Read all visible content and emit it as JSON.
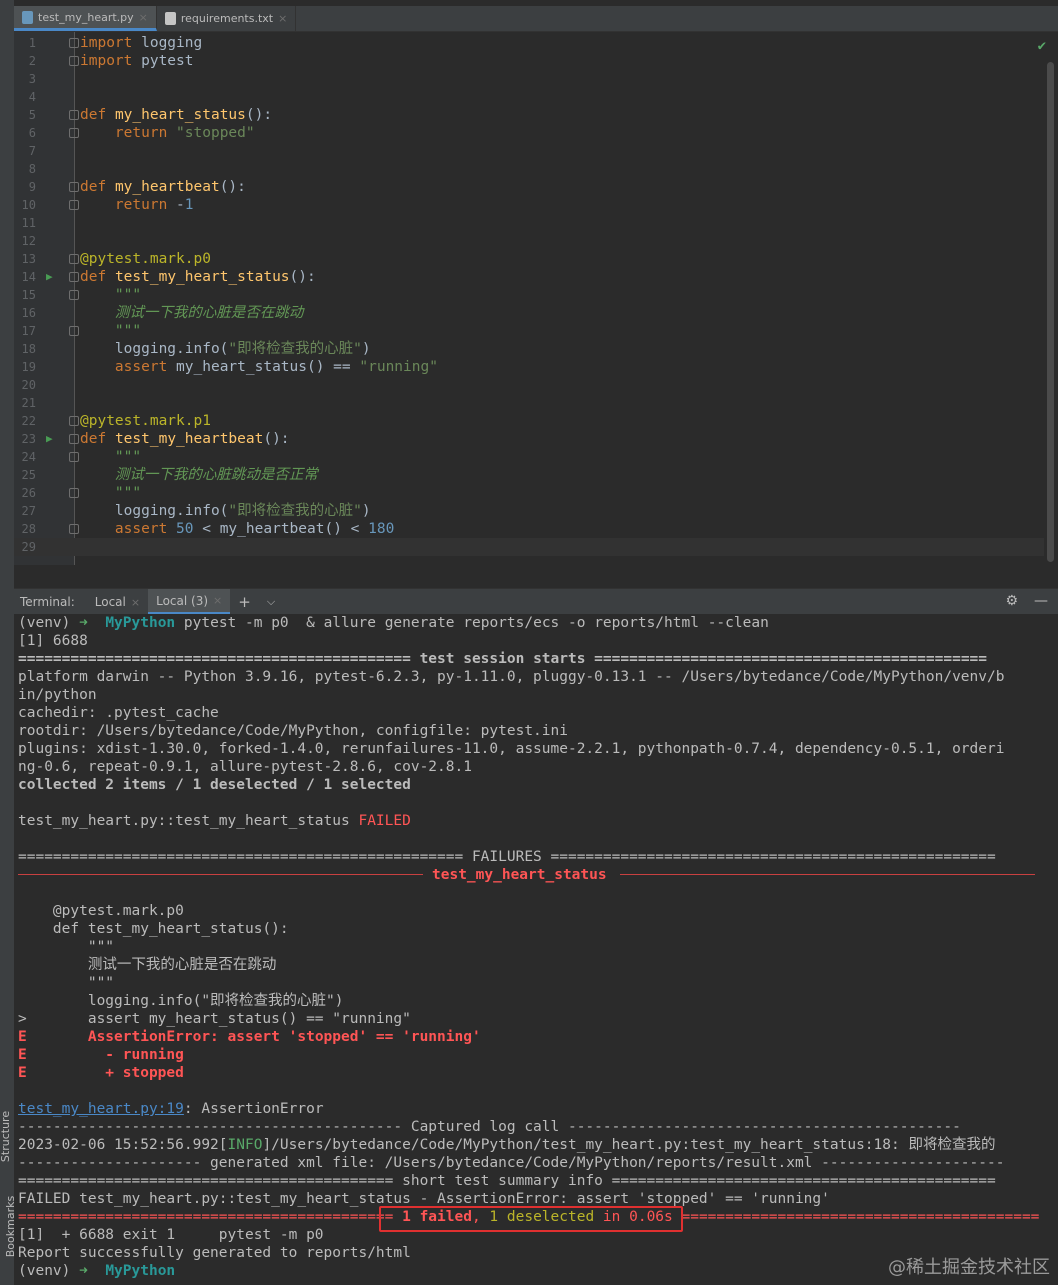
{
  "editor_tabs": [
    {
      "name": "test_my_heart.py"
    },
    {
      "name": "requirements.txt"
    }
  ],
  "code_lines": [
    "import logging",
    "import pytest",
    "",
    "",
    "def my_heart_status():",
    "    return \"stopped\"",
    "",
    "",
    "def my_heartbeat():",
    "    return -1",
    "",
    "",
    "@pytest.mark.p0",
    "def test_my_heart_status():",
    "    \"\"\"",
    "    测试一下我的心脏是否在跳动",
    "    \"\"\"",
    "    logging.info(\"即将检查我的心脏\")",
    "    assert my_heart_status() == \"running\"",
    "",
    "",
    "@pytest.mark.p1",
    "def test_my_heartbeat():",
    "    \"\"\"",
    "    测试一下我的心脏跳动是否正常",
    "    \"\"\"",
    "    logging.info(\"即将检查我的心脏\")",
    "    assert 50 < my_heartbeat() < 180",
    ""
  ],
  "line_numbers": [
    "1",
    "2",
    "3",
    "4",
    "5",
    "6",
    "7",
    "8",
    "9",
    "10",
    "11",
    "12",
    "13",
    "14",
    "15",
    "16",
    "17",
    "18",
    "19",
    "20",
    "21",
    "22",
    "23",
    "24",
    "25",
    "26",
    "27",
    "28",
    "29"
  ],
  "terminal": {
    "label": "Terminal:",
    "tabs": [
      "Local",
      "Local (3)"
    ],
    "prompt_venv": "(venv)",
    "prompt_arrow": "➜",
    "prompt_dir": "MyPython",
    "command": "pytest -m p0  & allure generate reports/ecs -o reports/html --clean",
    "lines": {
      "l2": "[1] 6688",
      "session_left": "============================================= ",
      "session_title": "test session starts",
      "session_right": " =============================================",
      "platform": "platform darwin -- Python 3.9.16, pytest-6.2.3, py-1.11.0, pluggy-0.13.1 -- /Users/bytedance/Code/MyPython/venv/b",
      "platform2": "in/python",
      "cachedir": "cachedir: .pytest_cache",
      "rootdir": "rootdir: /Users/bytedance/Code/MyPython, configfile: pytest.ini",
      "plugins": "plugins: xdist-1.30.0, forked-1.4.0, rerunfailures-11.0, assume-2.2.1, pythonpath-0.7.4, dependency-0.5.1, orderi",
      "plugins2": "ng-0.6, repeat-0.9.1, allure-pytest-2.8.6, cov-2.8.1",
      "collected": "collected 2 items / 1 deselected / 1 selected",
      "result_test": "test_my_heart.py::test_my_heart_status ",
      "result_status": "FAILED",
      "failures_line": "=================================================== FAILURES ===================================================",
      "fail_test": "test_my_heart_status",
      "tb1": "    @pytest.mark.p0",
      "tb2": "    def test_my_heart_status():",
      "tb3": "        \"\"\"",
      "tb4": "        测试一下我的心脏是否在跳动",
      "tb5": "        \"\"\"",
      "tb6": "        logging.info(\"即将检查我的心脏\")",
      "tb7": ">       assert my_heart_status() == \"running\"",
      "e1_mark": "E",
      "e1": "       AssertionError: assert 'stopped' == 'running'",
      "e2": "         - running",
      "e3": "         + stopped",
      "loc_link": "test_my_heart.py:19",
      "loc_rest": ": AssertionError",
      "captured": "-------------------------------------------- Captured log call ---------------------------------------------",
      "log_time": "2023-02-06 15:52:56.992",
      "log_level": "INFO",
      "log_rest": "]/Users/bytedance/Code/MyPython/test_my_heart.py:test_my_heart_status:18: 即将检查我的",
      "xml": "--------------------- generated xml file: /Users/bytedance/Code/MyPython/reports/result.xml ---------------------",
      "summary": "=========================================== short test summary info ============================================",
      "failed_line": "FAILED test_my_heart.py::test_my_heart_status - AssertionError: assert 'stopped' == 'running'",
      "final_left": "=========================================== ",
      "final_failed": "1 failed",
      "final_comma": ", ",
      "final_desel": "1 deselected",
      "final_in": " in 0.06s",
      "final_right": " =========================================",
      "exit_line": "[1]  + 6688 exit 1     pytest -m p0",
      "report_line": "Report successfully generated to reports/html"
    }
  },
  "side_tabs": [
    "Structure",
    "Bookmarks"
  ],
  "watermark": "@稀土掘金技术社区",
  "icons": {
    "check": "check-icon",
    "run": "run-gutter-icon",
    "settings": "gear-icon",
    "minimize": "minimize-icon",
    "add": "plus-icon",
    "dropdown": "chevron-down-icon"
  }
}
